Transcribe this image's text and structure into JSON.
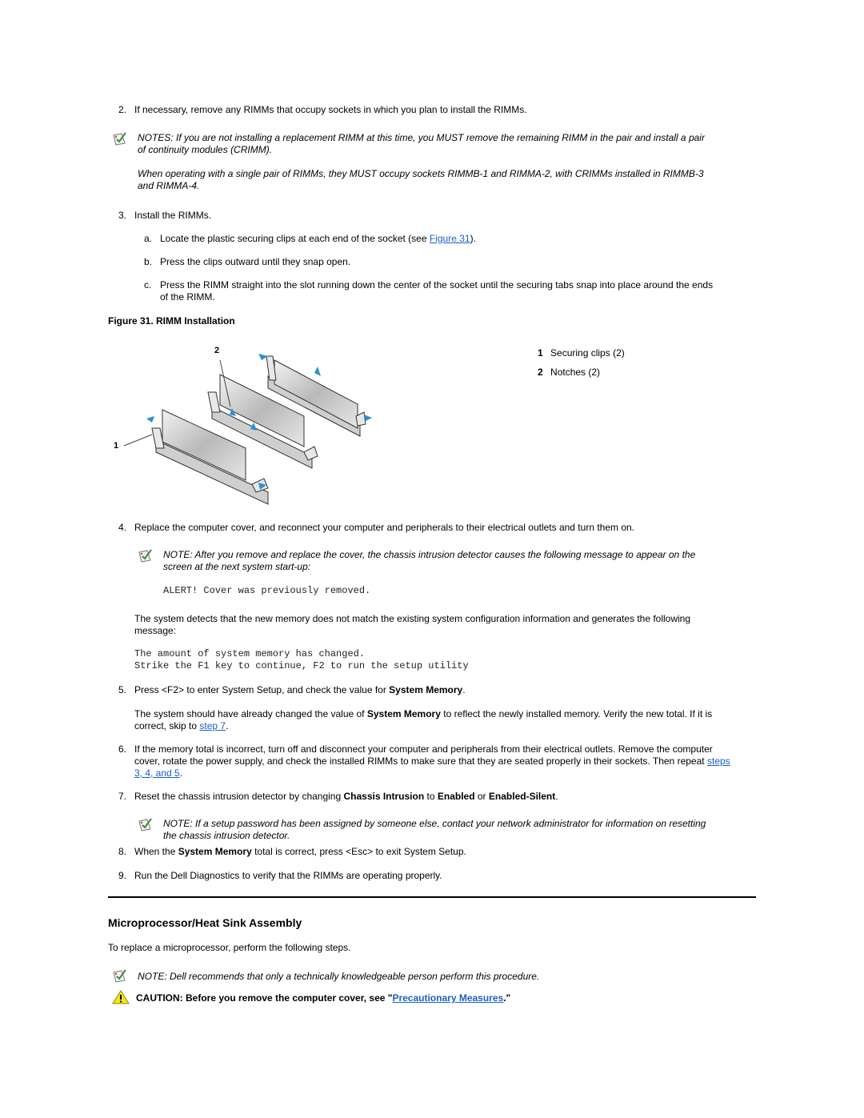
{
  "step2": {
    "num": "2.",
    "text": "If necessary, remove any RIMMs that occupy sockets in which you plan to install the RIMMs."
  },
  "notes1": {
    "line1": "NOTES: If you are not installing a replacement RIMM at this time, you MUST remove the remaining RIMM in the pair and install a pair",
    "line2": "of continuity modules (CRIMM).",
    "line3": "When operating with a single pair of RIMMs, they MUST occupy sockets RIMMB-1 and RIMMA-2, with CRIMMs installed in RIMMB-3",
    "line4": "and RIMMA-4."
  },
  "step3": {
    "num": "3.",
    "text": "Install the RIMMs.",
    "a": {
      "num": "a.",
      "pre": "Locate the plastic securing clips at each end of the socket (see ",
      "link": "Figure 31",
      "post": ")."
    },
    "b": {
      "num": "b.",
      "text": "Press the clips outward until they snap open."
    },
    "c": {
      "num": "c.",
      "line1": "Press the RIMM straight into the slot running down the center of the socket until the securing tabs snap into place around the ends",
      "line2": "of the RIMM."
    }
  },
  "figure": {
    "caption": "Figure 31. RIMM Installation",
    "callout1": "1",
    "callout2": "2",
    "legend": [
      {
        "num": "1",
        "label": "Securing clips (2)"
      },
      {
        "num": "2",
        "label": "Notches (2)"
      }
    ]
  },
  "step4": {
    "num": "4.",
    "text": "Replace the computer cover, and reconnect your computer and peripherals to their electrical outlets and turn them on.",
    "note_line1": "NOTE: After you remove and replace the cover, the chassis intrusion detector causes the following message to appear on the",
    "note_line2": "screen at the next system start-up:",
    "alert": "ALERT! Cover was previously removed.",
    "detect_line1": "The system detects that the new memory does not match the existing system configuration information and generates the following",
    "detect_line2": "message:",
    "msg1": "The amount of system memory has changed.",
    "msg2": "Strike the F1 key to continue, F2 to run the setup utility"
  },
  "step5": {
    "num": "5.",
    "pre": "Press <F2> to enter System Setup, and check the value for ",
    "bold": "System Memory",
    "post": ".",
    "p2_pre": "The system should have already changed the value of ",
    "p2_bold": "System Memory",
    "p2_post": " to reflect the newly installed memory. Verify the new total. If it is",
    "p2_line2_pre": "correct, skip to ",
    "p2_link": "step 7",
    "p2_line2_post": "."
  },
  "step6": {
    "num": "6.",
    "line1": "If the memory total is incorrect, turn off and disconnect your computer and peripherals from their electrical outlets. Remove the computer",
    "line2_pre": "cover, rotate the power supply, and check the installed RIMMs to make sure that they are seated properly in their sockets. Then repeat ",
    "line2_link": "steps",
    "line3_link": "3, 4, and 5",
    "line3_post": "."
  },
  "step7": {
    "num": "7.",
    "pre": "Reset the chassis intrusion detector by changing ",
    "b1": "Chassis Intrusion",
    "mid1": " to ",
    "b2": "Enabled",
    "mid2": " or ",
    "b3": "Enabled-Silent",
    "post": ".",
    "note_line1": "NOTE: If a setup password has been assigned by someone else, contact your network administrator for information on resetting",
    "note_line2": "the chassis intrusion detector."
  },
  "step8": {
    "num": "8.",
    "pre": "When the ",
    "bold": "System Memory",
    "post": " total is correct, press <Esc> to exit System Setup."
  },
  "step9": {
    "num": "9.",
    "text": "Run the Dell Diagnostics to verify that the RIMMs are operating properly."
  },
  "section": {
    "title": "Microprocessor/Heat Sink Assembly",
    "intro": "To replace a microprocessor, perform the following steps.",
    "note": "NOTE: Dell recommends that only a technically knowledgeable person perform this procedure.",
    "caution_pre": "CAUTION: Before you remove the computer cover, see \"",
    "caution_link": "Precautionary Measures",
    "caution_post": ".\""
  }
}
